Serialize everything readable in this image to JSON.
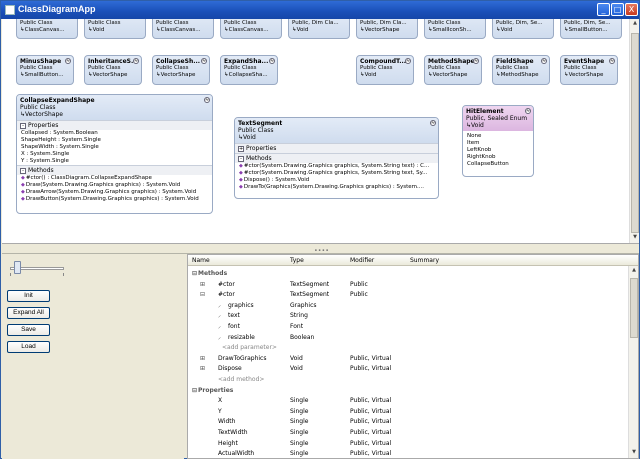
{
  "window": {
    "title": "ClassDiagramApp",
    "minimize": "_",
    "maximize": "□",
    "close": "X"
  },
  "collapse_glyph": "≈",
  "top_row": [
    {
      "type": "Public Class",
      "base": "ClassCanvas..."
    },
    {
      "type": "Public Class",
      "base": "Void"
    },
    {
      "type": "Public Class",
      "base": "ClassCanvas..."
    },
    {
      "type": "Public Class",
      "base": "ClassCanvas..."
    },
    {
      "type": "Public, Dim Cla...",
      "base": "Void"
    },
    {
      "type": "Public, Dim Cla...",
      "base": "VectorShape"
    },
    {
      "type": "Public Class",
      "base": "SmallIconSh..."
    },
    {
      "type": "Public, Dim, Se...",
      "base": "Void"
    },
    {
      "type": "Public, Dim, Se...",
      "base": "SmallButton..."
    }
  ],
  "second_row": [
    {
      "name": "MinusShape",
      "type": "Public Class",
      "base": "SmallButton..."
    },
    {
      "name": "InheritanceS...",
      "type": "Public Class",
      "base": "VectorShape"
    },
    {
      "name": "CollapseSh...",
      "type": "Public Class",
      "base": "VectorShape"
    },
    {
      "name": "ExpandSha...",
      "type": "Public Class",
      "base": "CollapseSha..."
    },
    {
      "name": "CompoundT...",
      "type": "Public Class",
      "base": "Void"
    },
    {
      "name": "MethodShape",
      "type": "Public Class",
      "base": "VectorShape"
    },
    {
      "name": "FieldShape",
      "type": "Public Class",
      "base": "MethodShape"
    },
    {
      "name": "EventShape",
      "type": "Public Class",
      "base": "VectorShape"
    }
  ],
  "collapse_expand_shape": {
    "name": "CollapseExpandShape",
    "type": "Public Class",
    "base": "VectorShape",
    "properties_label": "Properties",
    "properties": [
      "Collapsed : System.Boolean",
      "ShapeHeight : System.Single",
      "ShapeWidth : System.Single",
      "X : System.Single",
      "Y : System.Single"
    ],
    "methods_label": "Methods",
    "methods": [
      "#ctor() : ClassDiagram.CollapseExpandShape",
      "Draw(System.Drawing.Graphics graphics) : System.Void",
      "DrawArrow(System.Drawing.Graphics graphics) : System.Void",
      "DrawButton(System.Drawing.Graphics graphics) : System.Void"
    ]
  },
  "text_segment": {
    "name": "TextSegment",
    "type": "Public Class",
    "base": "Void",
    "properties_label": "Properties",
    "methods_label": "Methods",
    "methods": [
      "#ctor(System.Drawing.Graphics graphics, System.String text) : C...",
      "#ctor(System.Drawing.Graphics graphics, System.String text, Sy...",
      "Dispose() : System.Void",
      "DrawTo(Graphics(System.Drawing.Graphics graphics) : System...."
    ]
  },
  "hit_element": {
    "name": "HitElement",
    "type": "Public, Sealed Enum",
    "base": "Void",
    "values": [
      "None",
      "Item",
      "LeftKnob",
      "RightKnob",
      "CollapseButton"
    ]
  },
  "buttons": {
    "init": "Init",
    "expand_all": "Expand All",
    "save": "Save",
    "load": "Load"
  },
  "slider_value": 0.05,
  "grid": {
    "columns": [
      "Name",
      "Type",
      "Modifier",
      "Summary"
    ],
    "rows": [
      {
        "kind": "cat",
        "name": "Methods",
        "type": "",
        "mod": "",
        "lvl": 0,
        "exp": "-"
      },
      {
        "kind": "item",
        "name": "#ctor",
        "type": "TextSegment",
        "mod": "Public",
        "lvl": 1,
        "exp": "+"
      },
      {
        "kind": "item",
        "name": "#ctor",
        "type": "TextSegment",
        "mod": "Public",
        "lvl": 1,
        "exp": "-"
      },
      {
        "kind": "param",
        "name": "graphics",
        "type": "Graphics",
        "mod": "",
        "lvl": 2,
        "exp": ""
      },
      {
        "kind": "param",
        "name": "text",
        "type": "String",
        "mod": "",
        "lvl": 2,
        "exp": ""
      },
      {
        "kind": "param",
        "name": "font",
        "type": "Font",
        "mod": "",
        "lvl": 2,
        "exp": ""
      },
      {
        "kind": "param",
        "name": "resizable",
        "type": "Boolean",
        "mod": "",
        "lvl": 2,
        "exp": ""
      },
      {
        "kind": "add",
        "name": "<add parameter>",
        "type": "",
        "mod": "",
        "lvl": 2,
        "exp": ""
      },
      {
        "kind": "item",
        "name": "DrawToGraphics",
        "type": "Void",
        "mod": "Public, Virtual",
        "lvl": 1,
        "exp": "+"
      },
      {
        "kind": "item",
        "name": "Dispose",
        "type": "Void",
        "mod": "Public, Virtual",
        "lvl": 1,
        "exp": "+"
      },
      {
        "kind": "add",
        "name": "<add method>",
        "type": "",
        "mod": "",
        "lvl": 1,
        "exp": ""
      },
      {
        "kind": "cat",
        "name": "Properties",
        "type": "",
        "mod": "",
        "lvl": 0,
        "exp": "-"
      },
      {
        "kind": "item",
        "name": "X",
        "type": "Single",
        "mod": "Public, Virtual",
        "lvl": 1,
        "exp": ""
      },
      {
        "kind": "item",
        "name": "Y",
        "type": "Single",
        "mod": "Public, Virtual",
        "lvl": 1,
        "exp": ""
      },
      {
        "kind": "item",
        "name": "Width",
        "type": "Single",
        "mod": "Public, Virtual",
        "lvl": 1,
        "exp": ""
      },
      {
        "kind": "item",
        "name": "TextWidth",
        "type": "Single",
        "mod": "Public, Virtual",
        "lvl": 1,
        "exp": ""
      },
      {
        "kind": "item",
        "name": "Height",
        "type": "Single",
        "mod": "Public, Virtual",
        "lvl": 1,
        "exp": ""
      },
      {
        "kind": "item",
        "name": "ActualWidth",
        "type": "Single",
        "mod": "Public, Virtual",
        "lvl": 1,
        "exp": ""
      }
    ]
  }
}
